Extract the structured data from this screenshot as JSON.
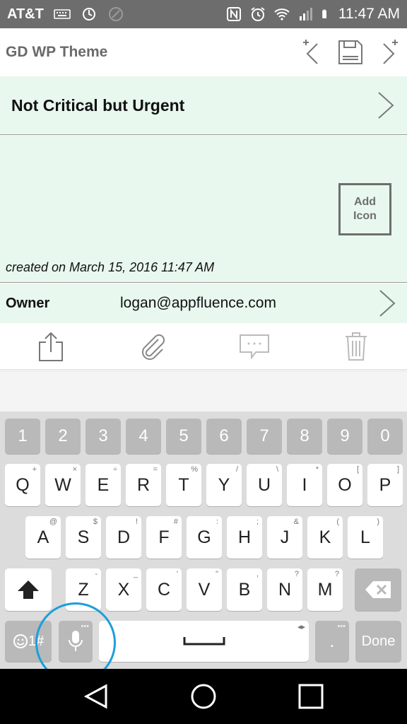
{
  "status_bar": {
    "carrier": "AT&T",
    "time": "11:47 AM"
  },
  "header": {
    "title": "GD WP Theme"
  },
  "record": {
    "title": "Not Critical but Urgent",
    "add_icon_line1": "Add",
    "add_icon_line2": "Icon",
    "created": "created on March 15, 2016 11:47 AM"
  },
  "owner": {
    "label": "Owner",
    "value": "logan@appfluence.com"
  },
  "keyboard": {
    "number_row": [
      "1",
      "2",
      "3",
      "4",
      "5",
      "6",
      "7",
      "8",
      "9",
      "0"
    ],
    "row1": [
      "Q",
      "W",
      "E",
      "R",
      "T",
      "Y",
      "U",
      "I",
      "O",
      "P"
    ],
    "row1_hints": [
      "+",
      "×",
      "÷",
      "=",
      "%",
      "/",
      "\\",
      "*",
      "[",
      "]"
    ],
    "row2": [
      "A",
      "S",
      "D",
      "F",
      "G",
      "H",
      "J",
      "K",
      "L"
    ],
    "row2_hints": [
      "@",
      "$",
      "!",
      "#",
      ":",
      ";",
      "&",
      "(",
      ")"
    ],
    "row3": [
      "Z",
      "X",
      "C",
      "V",
      "B",
      "N",
      "M"
    ],
    "row3_hints": [
      "-",
      "_",
      "'",
      "\"",
      ",",
      "?",
      "?"
    ],
    "symbols_label": "1#",
    "period_label": ".",
    "done_label": "Done"
  },
  "colors": {
    "panel_bg": "#e8f8ee",
    "status_bar": "#6d6d6d",
    "highlight": "#1a9fdc"
  }
}
